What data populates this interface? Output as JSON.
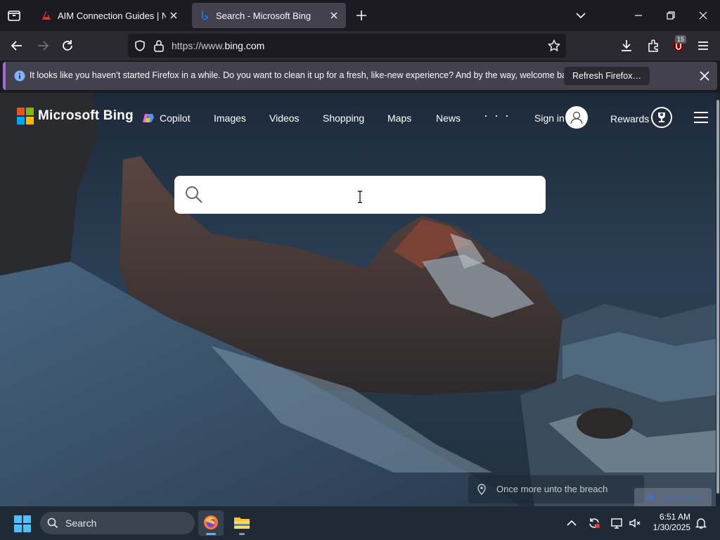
{
  "browser": {
    "tabs": [
      {
        "title": "AIM Connection Guides | NINA",
        "active": false
      },
      {
        "title": "Search - Microsoft Bing",
        "active": true
      }
    ],
    "url": {
      "prefix": "https://www.",
      "domain": "bing.com"
    },
    "extension_badge": "15",
    "notification": {
      "message": "It looks like you haven’t started Firefox in a while. Do you want to clean it up for a fresh, like-new experience? And by the way, welcome back!",
      "button": "Refresh Firefox…"
    }
  },
  "bing": {
    "brand": "Microsoft Bing",
    "nav": [
      "Copilot",
      "Images",
      "Videos",
      "Shopping",
      "Maps",
      "News"
    ],
    "more": "· · ·",
    "sign_in": "Sign in",
    "rewards": "Rewards",
    "search_placeholder": "",
    "location_caption": "Once more unto the breach",
    "feedback": "Feedback"
  },
  "taskbar": {
    "search_label": "Search",
    "time": "6:51 AM",
    "date": "1/30/2025"
  },
  "colors": {
    "accent_purple": "#a36bcf",
    "tab_active": "#42414d",
    "toolbar": "#2b2a33",
    "taskbar": "#1f2a36"
  }
}
